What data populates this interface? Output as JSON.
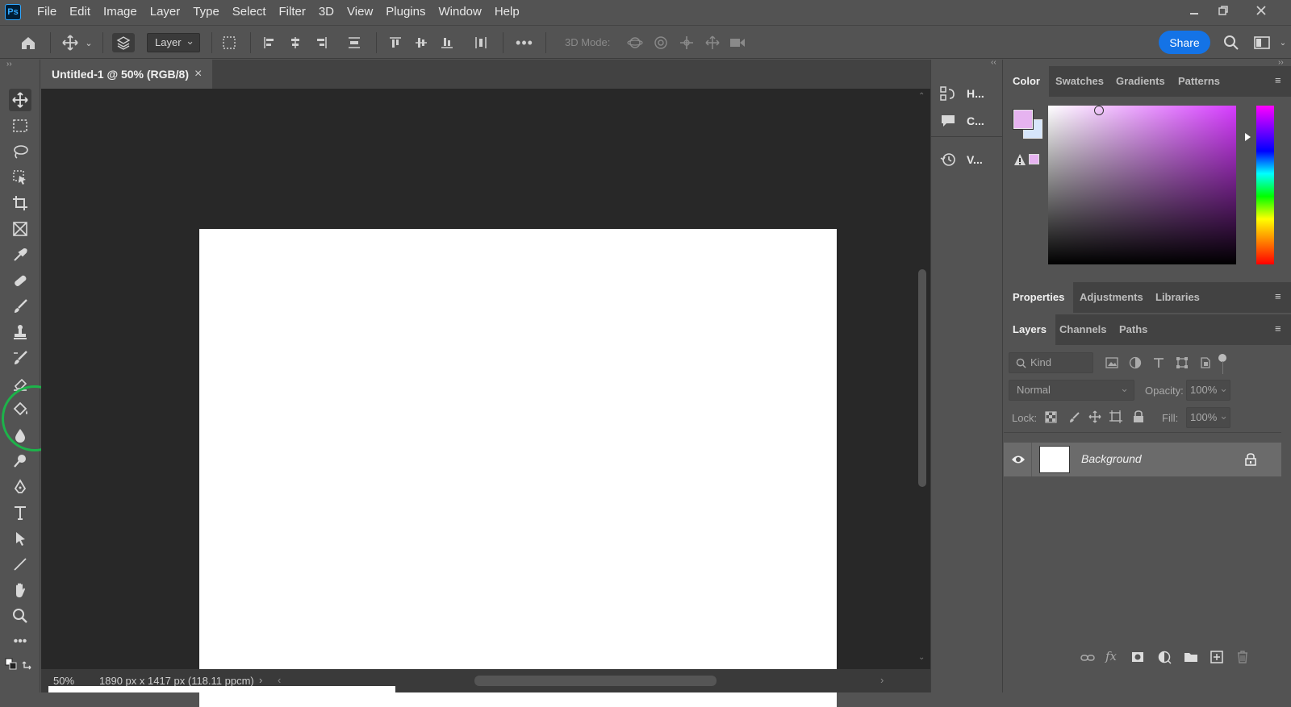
{
  "app": {
    "logo": "Ps",
    "menu": [
      "File",
      "Edit",
      "Image",
      "Layer",
      "Type",
      "Select",
      "Filter",
      "3D",
      "View",
      "Plugins",
      "Window",
      "Help"
    ]
  },
  "options_bar": {
    "layer_select": "Layer",
    "threed_mode_label": "3D Mode:",
    "share_label": "Share"
  },
  "document": {
    "tab_title": "Untitled-1 @ 50% (RGB/8)",
    "close_glyph": "×",
    "zoom": "50%",
    "doc_info": "1890 px x 1417 px (118.11 ppcm)"
  },
  "mid_panel": {
    "items": [
      "H...",
      "C...",
      "V..."
    ]
  },
  "color_panel": {
    "tabs": [
      "Color",
      "Swatches",
      "Gradients",
      "Patterns"
    ],
    "foreground": "#e6b3f0",
    "background": "#d7e6fb"
  },
  "properties_panel": {
    "tabs": [
      "Properties",
      "Adjustments",
      "Libraries"
    ]
  },
  "layers_panel": {
    "tabs": [
      "Layers",
      "Channels",
      "Paths"
    ],
    "filter_placeholder": "Kind",
    "blend_mode": "Normal",
    "opacity_label": "Opacity:",
    "opacity_value": "100%",
    "lock_label": "Lock:",
    "fill_label": "Fill:",
    "fill_value": "100%",
    "layers": [
      {
        "name": "Background"
      }
    ]
  },
  "colors": {
    "accent": "#1473e6",
    "highlight": "#1db34a"
  }
}
